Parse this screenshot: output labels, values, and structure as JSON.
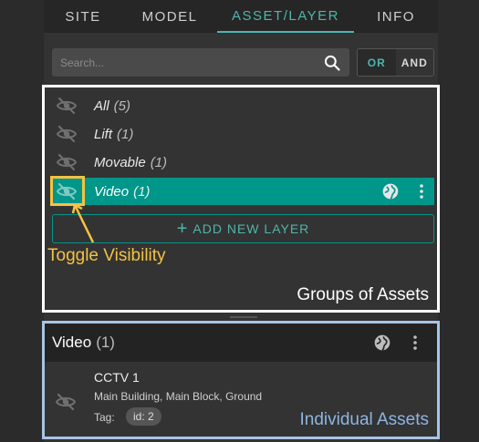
{
  "tabs": {
    "site": "SITE",
    "model": "MODEL",
    "asset_layer": "ASSET/LAYER",
    "info": "INFO"
  },
  "search": {
    "placeholder": "Search...",
    "value": ""
  },
  "filter_mode": {
    "or_label": "OR",
    "and_label": "AND",
    "selected": "OR"
  },
  "layers": [
    {
      "name": "All",
      "count": "(5)",
      "selected": false
    },
    {
      "name": "Lift",
      "count": "(1)",
      "selected": false
    },
    {
      "name": "Movable",
      "count": "(1)",
      "selected": false
    },
    {
      "name": "Video",
      "count": "(1)",
      "selected": true
    }
  ],
  "add_layer_label": "ADD NEW LAYER",
  "annotations": {
    "toggle_visibility": "Toggle Visibility",
    "groups_of_assets": "Groups of Assets",
    "individual_assets": "Individual Assets"
  },
  "asset_panel": {
    "title": "Video",
    "count": "(1)",
    "items": [
      {
        "name": "CCTV 1",
        "location": "Main Building, Main Block, Ground",
        "tag_label": "Tag:",
        "tag_value": "id: 2"
      }
    ]
  },
  "colors": {
    "accent": "#4db6ac",
    "selected_row": "#00968a",
    "highlight_yellow": "#f5c242",
    "groups_border": "#ffffff",
    "assets_border": "#a8c4e6"
  },
  "icons": [
    "eye-off-icon",
    "search-icon",
    "globe-icon",
    "more-vert-icon",
    "plus-icon"
  ]
}
